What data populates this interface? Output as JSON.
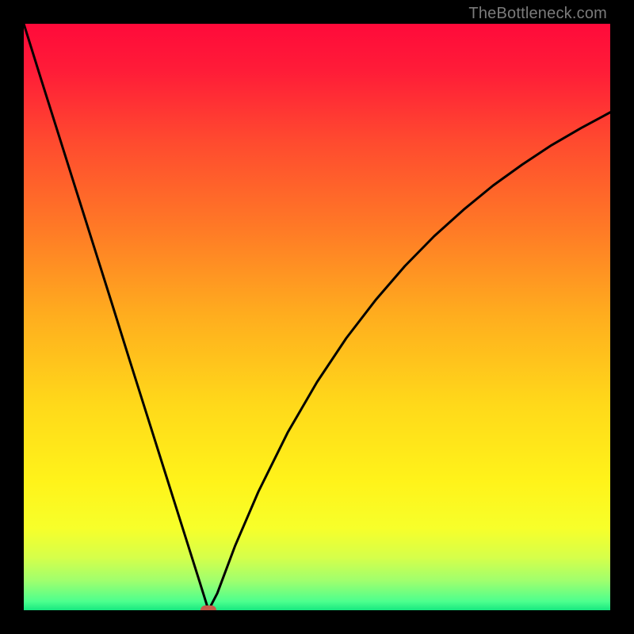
{
  "watermark": "TheBottleneck.com",
  "chart_data": {
    "type": "line",
    "title": "",
    "xlabel": "",
    "ylabel": "",
    "xlim": [
      0,
      100
    ],
    "ylim": [
      0,
      100
    ],
    "grid": false,
    "legend": false,
    "gradient_stops": [
      {
        "pos": 0.0,
        "color": "#ff0a3a"
      },
      {
        "pos": 0.08,
        "color": "#ff1c38"
      },
      {
        "pos": 0.2,
        "color": "#ff4a2f"
      },
      {
        "pos": 0.35,
        "color": "#ff7a26"
      },
      {
        "pos": 0.5,
        "color": "#ffae1e"
      },
      {
        "pos": 0.65,
        "color": "#ffd91a"
      },
      {
        "pos": 0.78,
        "color": "#fff31a"
      },
      {
        "pos": 0.86,
        "color": "#f7ff2a"
      },
      {
        "pos": 0.91,
        "color": "#d6ff4a"
      },
      {
        "pos": 0.95,
        "color": "#9fff6e"
      },
      {
        "pos": 0.985,
        "color": "#4dff8e"
      },
      {
        "pos": 1.0,
        "color": "#17e880"
      }
    ],
    "series": [
      {
        "name": "bottleneck-curve",
        "color": "#000000",
        "width": 3,
        "x": [
          0,
          3,
          6,
          9,
          12,
          15,
          18,
          21,
          24,
          27,
          30,
          31.5,
          33,
          36,
          40,
          45,
          50,
          55,
          60,
          65,
          70,
          75,
          80,
          85,
          90,
          95,
          100
        ],
        "y": [
          100,
          90.4,
          80.9,
          71.4,
          61.9,
          52.4,
          42.8,
          33.3,
          23.8,
          14.3,
          4.8,
          0.0,
          2.9,
          10.9,
          20.2,
          30.3,
          38.9,
          46.4,
          52.9,
          58.7,
          63.8,
          68.3,
          72.4,
          76.0,
          79.3,
          82.2,
          84.9
        ]
      }
    ],
    "marker": {
      "name": "optimal-point",
      "x": 31.5,
      "y": 0.0,
      "color": "#c65a4a"
    }
  }
}
